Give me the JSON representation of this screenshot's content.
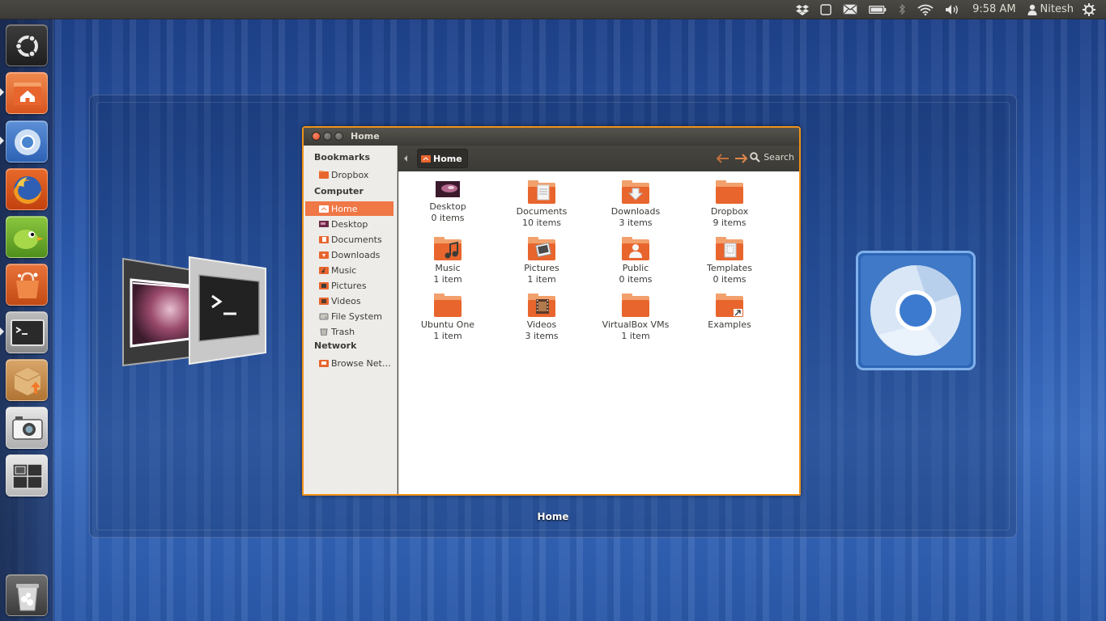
{
  "top_panel": {
    "clock": "9:58 AM",
    "user": "Nitesh",
    "tray_icons": [
      "dropbox-icon",
      "workspace-icon",
      "mail-icon",
      "battery-icon",
      "bluetooth-icon",
      "wifi-icon",
      "volume-icon",
      "user-icon",
      "settings-gear-icon"
    ]
  },
  "launcher": {
    "items": [
      {
        "name": "ubuntu-dash",
        "icon": "ubuntu-logo-icon",
        "running": false
      },
      {
        "name": "home-folder",
        "icon": "home-folder-icon",
        "running": true
      },
      {
        "name": "chromium",
        "icon": "chromium-icon",
        "running": true
      },
      {
        "name": "firefox",
        "icon": "firefox-icon",
        "running": false
      },
      {
        "name": "gwibber",
        "icon": "bird-icon",
        "running": false
      },
      {
        "name": "software-center",
        "icon": "shopping-bag-icon",
        "running": false
      },
      {
        "name": "terminal",
        "icon": "terminal-icon",
        "running": true
      },
      {
        "name": "update-manager",
        "icon": "package-upload-icon",
        "running": false
      },
      {
        "name": "camera-app",
        "icon": "camera-icon",
        "running": false
      },
      {
        "name": "workspace-switcher",
        "icon": "workspaces-icon",
        "running": false
      },
      {
        "name": "trash",
        "icon": "trash-icon",
        "running": false
      }
    ]
  },
  "switcher": {
    "label": "Home"
  },
  "window": {
    "title": "Home",
    "toolbar": {
      "path": "Home",
      "search_label": "Search"
    },
    "sidebar": {
      "bookmarks_heading": "Bookmarks",
      "bookmarks": [
        {
          "label": "Dropbox"
        }
      ],
      "computer_heading": "Computer",
      "computer": [
        {
          "label": "Home",
          "active": true
        },
        {
          "label": "Desktop"
        },
        {
          "label": "Documents"
        },
        {
          "label": "Downloads"
        },
        {
          "label": "Music"
        },
        {
          "label": "Pictures"
        },
        {
          "label": "Videos"
        },
        {
          "label": "File System"
        },
        {
          "label": "Trash"
        }
      ],
      "network_heading": "Network",
      "network": [
        {
          "label": "Browse Net…"
        }
      ]
    },
    "files": [
      {
        "name": "Desktop",
        "count": "0 items",
        "icon": "desktop-folder-icon"
      },
      {
        "name": "Documents",
        "count": "10 items",
        "icon": "documents-folder-icon"
      },
      {
        "name": "Downloads",
        "count": "3 items",
        "icon": "downloads-folder-icon"
      },
      {
        "name": "Dropbox",
        "count": "9 items",
        "icon": "folder-icon"
      },
      {
        "name": "Music",
        "count": "1 item",
        "icon": "music-folder-icon"
      },
      {
        "name": "Pictures",
        "count": "1 item",
        "icon": "pictures-folder-icon"
      },
      {
        "name": "Public",
        "count": "0 items",
        "icon": "public-folder-icon"
      },
      {
        "name": "Templates",
        "count": "0 items",
        "icon": "templates-folder-icon"
      },
      {
        "name": "Ubuntu One",
        "count": "1 item",
        "icon": "folder-icon"
      },
      {
        "name": "Videos",
        "count": "3 items",
        "icon": "videos-folder-icon"
      },
      {
        "name": "VirtualBox VMs",
        "count": "1 item",
        "icon": "folder-icon"
      },
      {
        "name": "Examples",
        "count": "",
        "icon": "examples-link-folder-icon"
      }
    ]
  },
  "colors": {
    "accent": "#f0921a",
    "selection": "#f07746",
    "folder": "#e8652d",
    "panel": "#3c3b37"
  }
}
